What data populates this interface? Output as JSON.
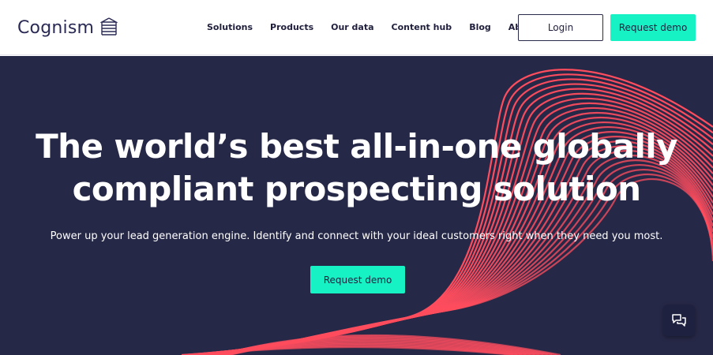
{
  "brand": {
    "name": "Cognism",
    "logo_icon": "stacked-lines-logo-icon",
    "text_color": "#2a2a55"
  },
  "nav": {
    "items": [
      {
        "label": "Solutions"
      },
      {
        "label": "Products"
      },
      {
        "label": "Our data"
      },
      {
        "label": "Content hub"
      },
      {
        "label": "Blog"
      },
      {
        "label": "About"
      }
    ],
    "login_label": "Login",
    "request_demo_label": "Request demo"
  },
  "hero": {
    "headline_line1": "The world’s best all-in-one globally",
    "headline_line2": "compliant prospecting solution",
    "subtext": "Power up your lead generation engine. Identify and connect with your ideal customers right when they need you most.",
    "cta_label": "Request demo",
    "background_color": "#262847",
    "wave_color": "#ff4d5e"
  },
  "chat": {
    "icon": "chat-bubbles-icon"
  },
  "colors": {
    "accent": "#17f2c5",
    "dark_text": "#1f1f3d"
  }
}
